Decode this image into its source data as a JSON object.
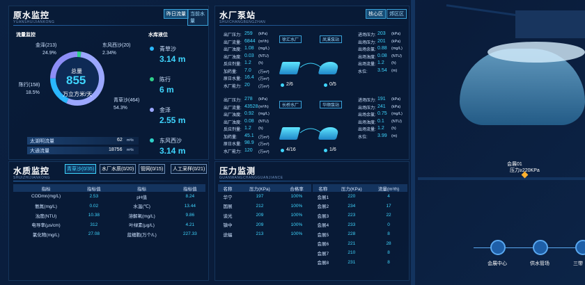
{
  "raw": {
    "title": "原水监控",
    "subtitle": "YUANSHUIJIANKONG",
    "btn_daily": "昨日流量",
    "btn_current": "当前水量",
    "flow_title": "流量监控",
    "center_label": "总量",
    "center_value": "855",
    "center_unit": "万立方米/天",
    "slices": [
      {
        "name": "金泽(213)",
        "pct": "24.9%",
        "value": 24.9,
        "color": "#8d8ef6"
      },
      {
        "name": "东风西沙(20)",
        "pct": "2.34%",
        "value": 2.34,
        "color": "#2fd08a"
      },
      {
        "name": "青草沙(464)",
        "pct": "54.3%",
        "value": 54.3,
        "color": "#9ba7ff"
      },
      {
        "name": "陈行(158)",
        "pct": "18.5%",
        "value": 18.5,
        "color": "#2ab7ff"
      }
    ],
    "reservoir_title": "水库液位",
    "reservoirs": [
      {
        "name": "青草沙",
        "value": "3.14 m",
        "color": "#2ab7ff"
      },
      {
        "name": "陈行",
        "value": "6 m",
        "color": "#2fd08a"
      },
      {
        "name": "金泽",
        "value": "2.55 m",
        "color": "#9ba7ff"
      },
      {
        "name": "东风西沙",
        "value": "3.14 m",
        "color": "#2fd0c8"
      }
    ],
    "flows": [
      {
        "label": "太湖明流量",
        "value": "62",
        "unit": "m³/s"
      },
      {
        "label": "大通流量",
        "value": "18756",
        "unit": "m³/s"
      }
    ]
  },
  "plant": {
    "title": "水厂泵站",
    "subtitle": "SHUICHANGBENGZHAN",
    "btn_center": "核心区",
    "btn_remote": "郊区区",
    "group1": {
      "left": [
        [
          "出厂压力:",
          "259",
          "(kPa)"
        ],
        [
          "出厂流量:",
          "6844",
          "(m³/h)"
        ],
        [
          "出厂浊度:",
          "1.08",
          "(mg/L)"
        ],
        [
          "出厂浊度:",
          "0.03",
          "(NTU)"
        ],
        [
          "反应剂量:",
          "1.2",
          "(h)"
        ],
        [
          "加药量:",
          "7.0",
          "(万m³)"
        ],
        [
          "原日水量:",
          "16.4",
          "(万m³)"
        ],
        [
          "水厂能力:",
          "20",
          "(万m³)"
        ]
      ],
      "pump_a": "徐汇水厂",
      "pump_b": "凤溪泵站",
      "count_a": "2/6",
      "count_b": "0/5",
      "right": [
        [
          "进场压力:",
          "203",
          "(kPa)"
        ],
        [
          "出场压力:",
          "201",
          "(kPa)"
        ],
        [
          "出场余氯:",
          "0.88",
          "(mg/L)"
        ],
        [
          "出场浊度:",
          "0.08",
          "(NTU)"
        ],
        [
          "出场流量:",
          "1.2",
          "(h)"
        ],
        [
          "水位:",
          "3.54",
          "(m)"
        ]
      ]
    },
    "group2": {
      "left": [
        [
          "出厂压力:",
          "278",
          "(kPa)"
        ],
        [
          "出厂流量:",
          "43528",
          "(m³/h)"
        ],
        [
          "出厂浊度:",
          "0.92",
          "(mg/L)"
        ],
        [
          "出厂浊度:",
          "0.08",
          "(NTU)"
        ],
        [
          "反应剂量:",
          "1.2",
          "(h)"
        ],
        [
          "加药量:",
          "45.1",
          "(万m³)"
        ],
        [
          "原日水量:",
          "98.9",
          "(万m³)"
        ],
        [
          "水厂能力:",
          "120",
          "(万m³)"
        ]
      ],
      "pump_a": "长桥水厂",
      "pump_b": "华顺泵站",
      "count_a": "4/16",
      "count_b": "1/6",
      "right": [
        [
          "进场压力:",
          "191",
          "(kPa)"
        ],
        [
          "出场压力:",
          "241",
          "(kPa)"
        ],
        [
          "出场余氯:",
          "0.75",
          "(mg/L)"
        ],
        [
          "出场浊度:",
          "0.1",
          "(NTU)"
        ],
        [
          "出场流量:",
          "1.2",
          "(h)"
        ],
        [
          "水位:",
          "3.99",
          "(m)"
        ]
      ]
    }
  },
  "quality": {
    "title": "水质监控",
    "subtitle": "SHUIZHIJIANKONG",
    "tabs": [
      "青草沙(0/35)",
      "水厂水质(0/20)",
      "管网(0/15)",
      "人工采样(0/21)"
    ],
    "headers": [
      "指标",
      "指标值",
      "指标",
      "指标值"
    ],
    "rows": [
      [
        "CODmn(mg/L)",
        "2.53",
        "pH值",
        "8.24"
      ],
      [
        "氨氮(mg/L)",
        "0.02",
        "水温(℃)",
        "13.44"
      ],
      [
        "浊度(NTU)",
        "10.38",
        "溶解氧(mg/L)",
        "9.86"
      ],
      [
        "电导率(μs/cm)",
        "312",
        "叶绿素(μg/L)",
        "4.21"
      ],
      [
        "氯化物(mg/L)",
        "27.08",
        "蓝细胞(万个/L)",
        "227.33"
      ]
    ]
  },
  "pressure": {
    "title": "压力监测",
    "subtitle": "GUANWANGCHANGGUANJIANCE",
    "left_headers": [
      "名称",
      "压力(KPa)",
      "合格率"
    ],
    "right_headers": [
      "名称",
      "压力(KPa)",
      "流量(m³/h)"
    ],
    "left_rows": [
      [
        "华宁",
        "197",
        "100%"
      ],
      [
        "国展",
        "212",
        "100%"
      ],
      [
        "谈光",
        "209",
        "100%"
      ],
      [
        "镇中",
        "209",
        "100%"
      ],
      [
        "途蝠",
        "213",
        "100%"
      ]
    ],
    "right_rows": [
      [
        "会展1",
        "220",
        "4"
      ],
      [
        "会展2",
        "234",
        "17"
      ],
      [
        "会展3",
        "223",
        "22"
      ],
      [
        "会展4",
        "233",
        "0"
      ],
      [
        "会展5",
        "228",
        "8"
      ],
      [
        "会展6",
        "221",
        "28"
      ],
      [
        "会展7",
        "210",
        "8"
      ],
      [
        "会展8",
        "231",
        "8"
      ]
    ]
  },
  "map": {
    "marker_name": "会展01",
    "marker_value": "压力≥220KPa",
    "nav": [
      "会展中心",
      "供水管场",
      "三带"
    ]
  }
}
